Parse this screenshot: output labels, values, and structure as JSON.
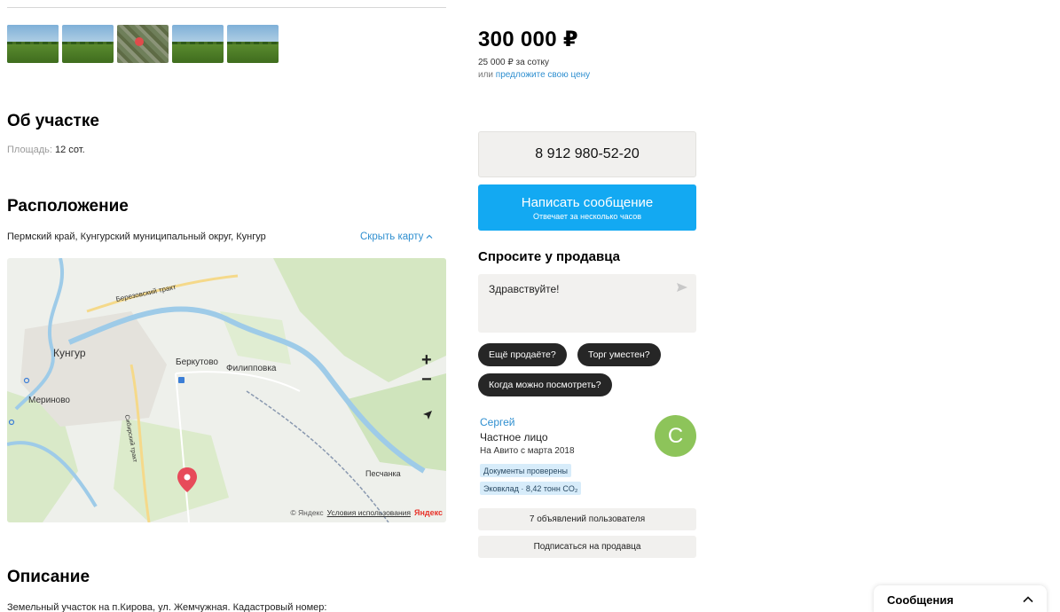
{
  "gallery": {
    "thumbs": [
      {
        "kind": "landscape",
        "active": true
      },
      {
        "kind": "landscape",
        "active": false
      },
      {
        "kind": "aerial",
        "active": false
      },
      {
        "kind": "landscape",
        "active": false
      },
      {
        "kind": "landscape",
        "active": false
      }
    ]
  },
  "about": {
    "title": "Об участке",
    "area_label": "Площадь:",
    "area_value": "12 сот."
  },
  "location": {
    "title": "Расположение",
    "address": "Пермский край, Кунгурский муниципальный округ, Кунгур",
    "hide_map": "Скрыть карту",
    "map": {
      "labels": {
        "city": "Кунгур",
        "berkutovo": "Беркутово",
        "filippovka": "Филипповка",
        "merinovo": "Мериново",
        "peschanka": "Песчанка",
        "tract": "Березовский тракт",
        "road2": "Сибирский тракт"
      },
      "zoom_in": "+",
      "zoom_out": "−",
      "copyright": "© Яндекс",
      "terms": "Условия использования",
      "logo": "Яндекс"
    }
  },
  "description": {
    "title": "Описание",
    "text": "Земельный участок на п.Кирова, ул. Жемчужная. Кадастровый номер:"
  },
  "listing": {
    "price": "300 000 ₽",
    "per_unit": "25 000 ₽ за сотку",
    "offer_prefix": "или",
    "offer_link": "предложите свою цену",
    "phone": "8 912 980-52-20",
    "message_button": "Написать сообщение",
    "message_sub": "Отвечает за несколько часов"
  },
  "ask": {
    "title": "Спросите у продавца",
    "input_value": "Здравствуйте!",
    "chips": [
      "Ещё продаёте?",
      "Торг уместен?",
      "Когда можно посмотреть?"
    ]
  },
  "seller": {
    "name": "Сергей",
    "type": "Частное лицо",
    "since": "На Авито с марта 2018",
    "badge_docs": "Документы проверены",
    "badge_eco": "Эковклад · 8,42 тонн CO₂",
    "avatar_letter": "С",
    "listings_button": "7 объявлений пользователя",
    "subscribe_button": "Подписаться на продавца"
  },
  "messages": {
    "title": "Сообщения"
  },
  "colors": {
    "accent_blue": "#13a9f2",
    "link_blue": "#2f8fd0",
    "avatar_green": "#8dc45a",
    "chip_dark": "#262626"
  }
}
